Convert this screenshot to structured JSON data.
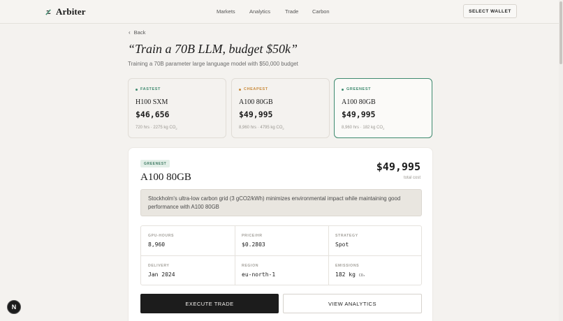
{
  "header": {
    "brand": "Arbiter",
    "nav": [
      "Markets",
      "Analytics",
      "Trade",
      "Carbon"
    ],
    "wallet_button": "SELECT WALLET"
  },
  "page": {
    "back_label": "Back",
    "title": "“Train a 70B LLM, budget $50k”",
    "subtitle": "Training a 70B parameter large language model with $50,000 budget"
  },
  "options": [
    {
      "tag": "FASTEST",
      "tag_color": "#3e8a6f",
      "gpu": "H100 SXM",
      "price": "$46,656",
      "hours": "720 hrs",
      "co2": "2275 kg CO",
      "co2_sub": "2"
    },
    {
      "tag": "CHEAPEST",
      "tag_color": "#c98a3a",
      "gpu": "A100 80GB",
      "price": "$49,995",
      "hours": "8,960 hrs",
      "co2": "4795 kg CO",
      "co2_sub": "2"
    },
    {
      "tag": "GREENEST",
      "tag_color": "#3e8a6f",
      "gpu": "A100 80GB",
      "price": "$49,995",
      "hours": "8,960 hrs",
      "co2": "182 kg CO",
      "co2_sub": "2"
    }
  ],
  "detail": {
    "badge": "GREENEST",
    "gpu": "A100 80GB",
    "total": "$49,995",
    "total_label": "total cost",
    "reason": "Stockholm's ultra-low carbon grid (3 gCO2/kWh) minimizes environmental impact while maintaining good performance with A100 80GB",
    "stats": [
      {
        "label": "GPU-HOURS",
        "value": "8,960"
      },
      {
        "label": "PRICE/HR",
        "value": "$0.2803"
      },
      {
        "label": "STRATEGY",
        "value": "Spot"
      },
      {
        "label": "DELIVERY",
        "value": "Jan 2024"
      },
      {
        "label": "REGION",
        "value": "eu-north-1"
      },
      {
        "label": "EMISSIONS",
        "value": "182 kg",
        "unit": "CO₂"
      }
    ],
    "execute_button": "EXECUTE TRADE",
    "analytics_button": "VIEW ANALYTICS"
  },
  "fab_label": "N"
}
